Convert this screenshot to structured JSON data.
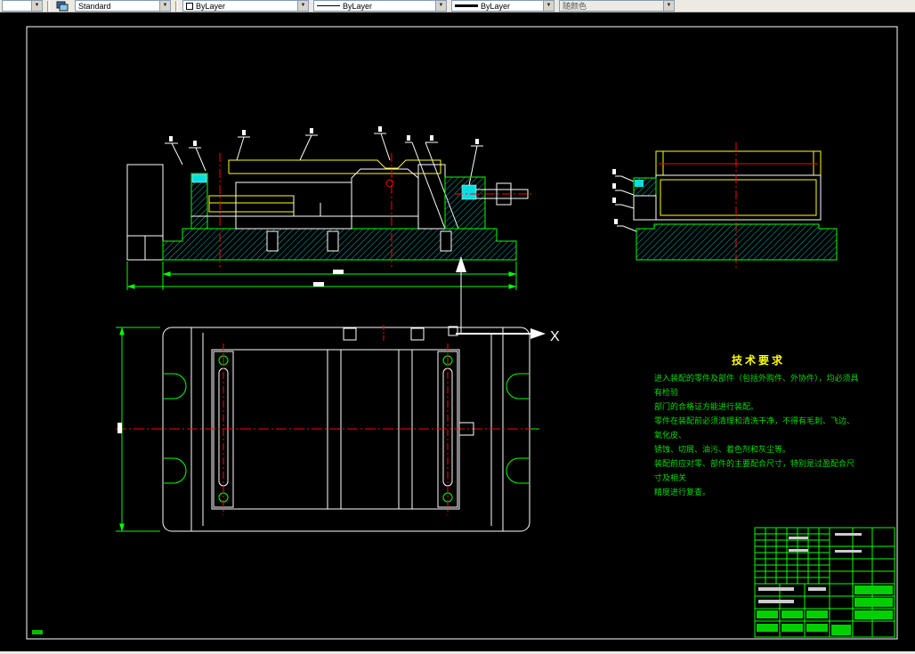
{
  "toolbar": {
    "style_combo": "Standard",
    "color_combo": "ByLayer",
    "linetype_combo": "ByLayer",
    "lineweight_combo": "ByLayer",
    "plotstyle_combo": "随颜色"
  },
  "drawing": {
    "ucs_x_label": "X",
    "tech_requirements": {
      "title": "技术要求",
      "lines": [
        "进入装配的零件及部件（包括外购件、外协件），均必须具有检验",
        "部门的合格证方能进行装配。",
        "零件在装配前必须清理和清洗干净，不得有毛刺、飞边、氧化皮、",
        "锈蚀、切屑、油污、着色剂和灰尘等。",
        "装配前应对零、部件的主要配合尺寸，特别是过盈配合尺寸及相关",
        "精度进行复查。"
      ]
    }
  },
  "colors": {
    "line_green": "#00ff00",
    "line_yellow": "#ffff00",
    "line_red": "#ff0000",
    "line_white": "#ffffff",
    "hatch_cyan": "#00b4b4",
    "highlight_cyan": "#00e0e0"
  }
}
